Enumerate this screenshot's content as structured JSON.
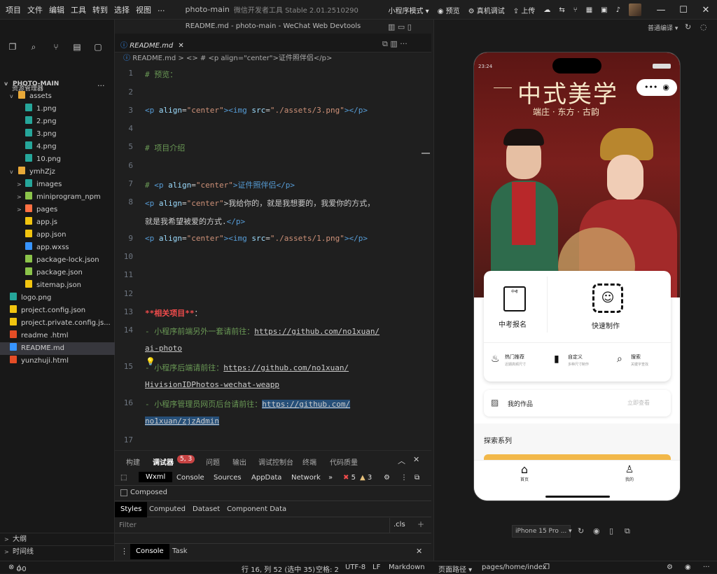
{
  "menu": [
    "项目",
    "文件",
    "编辑",
    "工具",
    "转到",
    "选择",
    "视图",
    "..."
  ],
  "app_title": "photo-main",
  "app_subtitle": "微信开发者工具 Stable 2.01.2510290",
  "toolbar": {
    "mode": "小程序模式 ▾",
    "preview": "预览",
    "real_debug": "真机调试",
    "upload": "上传"
  },
  "sim_compile": "普通编译 ▾",
  "sidebar": {
    "header": "资源管理器",
    "root": "PHOTO-MAIN",
    "items": [
      {
        "label": "assets",
        "type": "folder",
        "depth": 1,
        "open": true
      },
      {
        "label": "1.png",
        "type": "png",
        "depth": 2
      },
      {
        "label": "2.png",
        "type": "png",
        "depth": 2
      },
      {
        "label": "3.png",
        "type": "png",
        "depth": 2
      },
      {
        "label": "4.png",
        "type": "png",
        "depth": 2
      },
      {
        "label": "10.png",
        "type": "png",
        "depth": 2
      },
      {
        "label": "ymhZjz",
        "type": "folder",
        "depth": 1,
        "open": true
      },
      {
        "label": "images",
        "type": "folder-img",
        "depth": 2
      },
      {
        "label": "miniprogram_npm",
        "type": "folder-npm",
        "depth": 2
      },
      {
        "label": "pages",
        "type": "folder-pages",
        "depth": 2
      },
      {
        "label": "app.js",
        "type": "js",
        "depth": 2
      },
      {
        "label": "app.json",
        "type": "json",
        "depth": 2
      },
      {
        "label": "app.wxss",
        "type": "wxss",
        "depth": 2
      },
      {
        "label": "package-lock.json",
        "type": "npm",
        "depth": 2
      },
      {
        "label": "package.json",
        "type": "npm",
        "depth": 2
      },
      {
        "label": "sitemap.json",
        "type": "json",
        "depth": 2
      },
      {
        "label": "logo.png",
        "type": "png",
        "depth": 1
      },
      {
        "label": "project.config.json",
        "type": "json",
        "depth": 1
      },
      {
        "label": "project.private.config.js...",
        "type": "json",
        "depth": 1
      },
      {
        "label": "readme .html",
        "type": "html",
        "depth": 1
      },
      {
        "label": "README.md",
        "type": "md",
        "depth": 1,
        "selected": true
      },
      {
        "label": "yunzhuji.html",
        "type": "html",
        "depth": 1
      }
    ],
    "outline": "大纲",
    "timeline": "时间线"
  },
  "editor": {
    "window_title": "README.md - photo-main - WeChat Web Devtools",
    "tab": "README.md",
    "breadcrumb": "README.md > <> # <p align=\"center\">证件照伴侣</p>"
  },
  "code_lines": [
    "1",
    "2",
    "3",
    "4",
    "5",
    "6",
    "7",
    "8",
    "9",
    "10",
    "11",
    "12",
    "13",
    "14",
    "15",
    "16",
    "17"
  ],
  "code": {
    "l1": "# 预览：",
    "l3a": "<p ",
    "l3b": "align",
    "l3c": "=",
    "l3d": "\"center\"",
    "l3e": "><img ",
    "l3f": "src",
    "l3g": "=",
    "l3h": "\"./assets/3.png\"",
    "l3i": "></p>",
    "l5": "# 项目介绍",
    "l7a": "# ",
    "l7b": "<p ",
    "l7c": "align",
    "l7d": "=",
    "l7e": "\"center\"",
    "l7f": ">证件照伴侣</p>",
    "l8a": "<p ",
    "l8b": "align",
    "l8c": "=",
    "l8d": "\"center\"",
    "l8e": ">我给你的，就是我想要的，我爱你的方式，",
    "l8f": "就是我希望被爱的方式.",
    "l8g": "</p>",
    "l9a": "<p ",
    "l9b": "align",
    "l9c": "=",
    "l9d": "\"center\"",
    "l9e": "><img ",
    "l9f": "src",
    "l9g": "=",
    "l9h": "\"./assets/1.png\"",
    "l9i": "></p>",
    "l13a": "**相关项目**",
    "l13b": "：",
    "l14a": "- 小程序前端另外一套请前往：",
    "l14b": "https://github.com/no1xuan/",
    "l14c": "ai-photo",
    "l15a": "- 小程序后端请前往：",
    "l15b": "https://github.com/no1xuan/",
    "l15c": "HivisionIDPhotos-wechat-weapp",
    "l16a": "- 小程序管理员网页后台请前往：",
    "l16b": "https://github.com/",
    "l16c": "no1xuan/zjzAdmin"
  },
  "panel": {
    "tabs": [
      "构建",
      "调试器",
      "问题",
      "输出",
      "调试控制台",
      "终端",
      "代码质量"
    ],
    "badge": "5, 3",
    "devtabs": [
      "Wxml",
      "Console",
      "Sources",
      "AppData",
      "Network"
    ],
    "errors": "5",
    "warnings": "3",
    "composed": "Composed",
    "styletabs": [
      "Styles",
      "Computed",
      "Dataset",
      "Component Data"
    ],
    "filter": "Filter",
    "cls": ".cls",
    "drawer_console": "Console",
    "drawer_task": "Task"
  },
  "status": {
    "errors": "0",
    "warnings": "0",
    "cursor": "行 16, 列 52 (选中 35)",
    "spaces": "空格: 2",
    "encoding": "UTF-8",
    "eol": "LF",
    "lang": "Markdown",
    "page_path_label": "页面路径 ▾",
    "page_path": "pages/home/index"
  },
  "phone": {
    "time": "23:24",
    "hero_title": "中式美学",
    "hero_sub": "端庄 · 东方 · 古韵",
    "card": {
      "left": "中考报名",
      "right": "快速制作",
      "minis": [
        {
          "t": "热门推荐",
          "s": "近期高频尺寸"
        },
        {
          "t": "自定义",
          "s": "多种尺寸制作"
        },
        {
          "t": "搜索",
          "s": "关键字查找"
        }
      ]
    },
    "works": "我的作品",
    "works_link": "立即查看",
    "explore": "探索系列",
    "nav": [
      "首页",
      "我的"
    ],
    "device": "iPhone 15 Pro ... ▾"
  }
}
